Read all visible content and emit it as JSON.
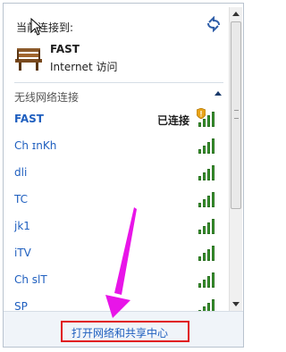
{
  "header": {
    "title": "当前连接到:",
    "current_network": "FAST",
    "current_type": "Internet 访问"
  },
  "section": {
    "label": "无线网络连接"
  },
  "networks": [
    {
      "name": "FAST",
      "status": "已连接",
      "signal": 4,
      "connected": true
    },
    {
      "name": "Ch          ɪnKh",
      "status": "",
      "signal": 4,
      "connected": false
    },
    {
      "name": "dli",
      "status": "",
      "signal": 4,
      "connected": false
    },
    {
      "name": "TC",
      "status": "",
      "signal": 4,
      "connected": false
    },
    {
      "name": "jk1",
      "status": "",
      "signal": 4,
      "connected": false
    },
    {
      "name": "iTV",
      "status": "",
      "signal": 4,
      "connected": false
    },
    {
      "name": "Ch          slT",
      "status": "",
      "signal": 4,
      "connected": false
    },
    {
      "name": "SP",
      "status": "",
      "signal": 4,
      "connected": false
    }
  ],
  "footer": {
    "open_center_label": "打开网络和共享中心"
  },
  "colors": {
    "link": "#1f5fbf",
    "highlight_box": "#e0141b",
    "annotation_arrow": "#e815e8",
    "signal_green": "#3a9b2f"
  }
}
